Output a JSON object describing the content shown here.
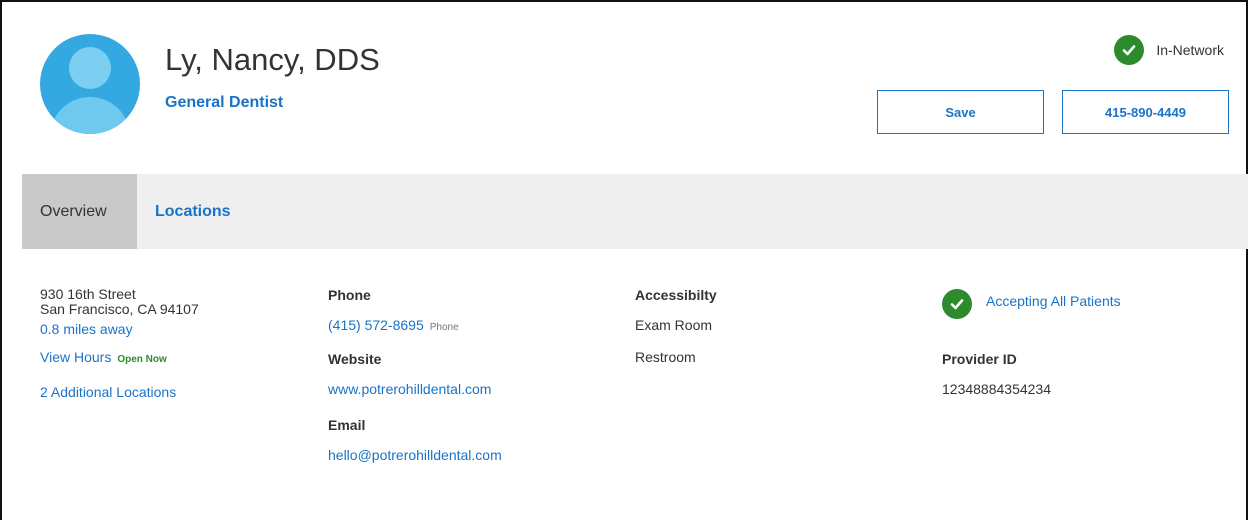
{
  "provider": {
    "name": "Ly, Nancy, DDS",
    "specialty": "General Dentist",
    "network_status": "In-Network"
  },
  "actions": {
    "save_label": "Save",
    "phone_label": "415-890-4449"
  },
  "tabs": [
    {
      "label": "Overview",
      "active": true
    },
    {
      "label": "Locations",
      "active": false
    }
  ],
  "address": {
    "street": "930 16th Street",
    "city": "San Francisco, CA 94107",
    "distance": "0.8 miles away",
    "view_hours": "View Hours",
    "open_status": "Open Now",
    "additional_locations": "2 Additional Locations"
  },
  "contact": {
    "phone_heading": "Phone",
    "phone_value": "(415) 572-8695",
    "phone_type": "Phone",
    "website_heading": "Website",
    "website_value": "www.potrerohilldental.com",
    "email_heading": "Email",
    "email_value": "hello@potrerohilldental.com"
  },
  "accessibility": {
    "heading": "Accessibilty",
    "items": [
      "Exam Room",
      "Restroom"
    ]
  },
  "patients": {
    "status": "Accepting All Patients",
    "provider_id_heading": "Provider ID",
    "provider_id_value": "12348884354234"
  },
  "colors": {
    "accent": "#1a73c8",
    "check_green": "#2d8a2d",
    "tab_bar": "#efefef",
    "tab_active": "#c9c9c9",
    "avatar": "#34a9e1"
  }
}
